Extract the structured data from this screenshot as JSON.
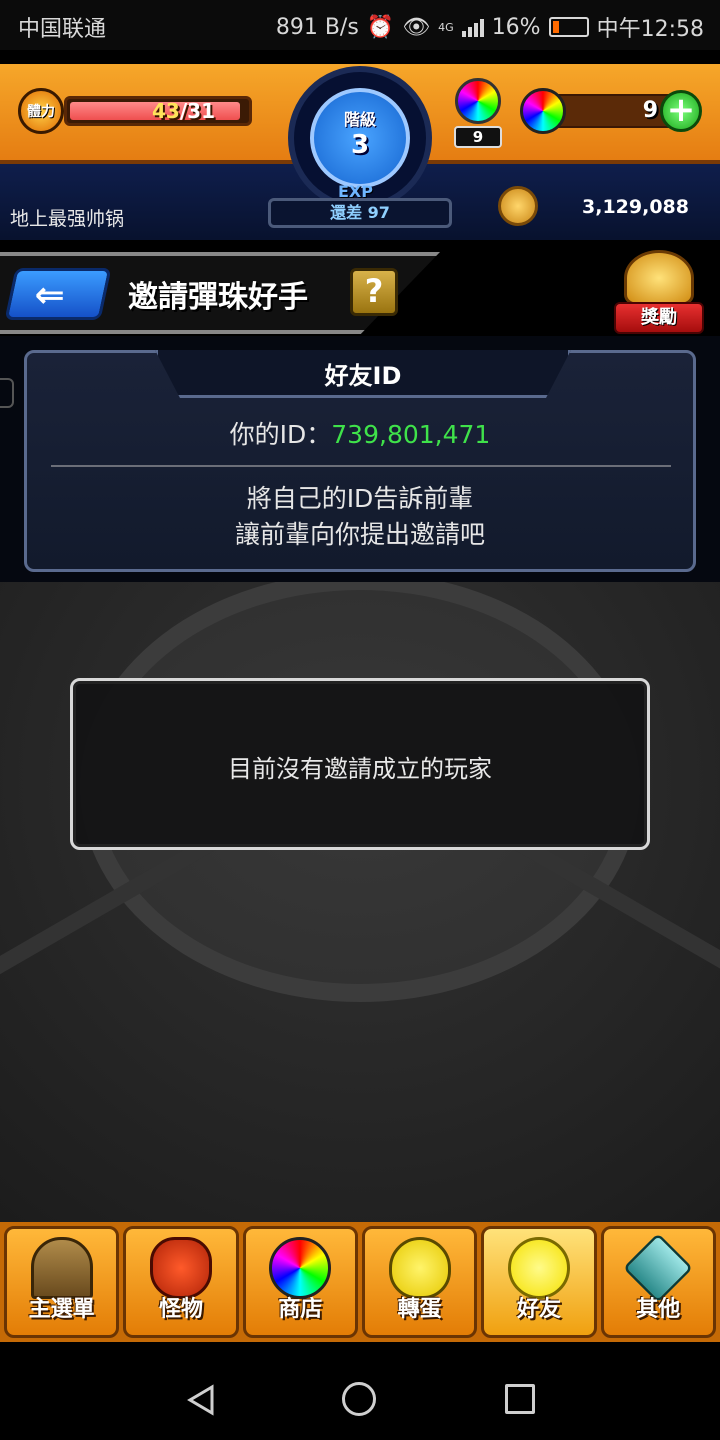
{
  "status_bar": {
    "carrier": "中国联通",
    "net_speed": "891 B/s",
    "battery": "16%",
    "time": "中午12:58",
    "signal_label": "4G"
  },
  "header": {
    "stamina_label": "體力",
    "stamina_current": "43",
    "stamina_max": "/31",
    "rank_label": "階級",
    "rank_value": "3",
    "exp_label": "EXP",
    "exp_remaining": "還差 97",
    "orb_count_small": "9",
    "orb_count": "9",
    "player_name": "地上最强帅锅",
    "coins": "3,129,088"
  },
  "titlebar": {
    "title": "邀請彈珠好手",
    "help": "?",
    "reward": "獎勵"
  },
  "id_panel": {
    "tab_title": "好友ID",
    "id_prefix": "你的ID：",
    "id_value": "739,801,471",
    "note_line1": "將自己的ID告訴前輩",
    "note_line2": "讓前輩向你提出邀請吧"
  },
  "empty_message": "目前沒有邀請成立的玩家",
  "bottom_nav": {
    "items": [
      {
        "label": "主選單",
        "icon": "home-gate-icon"
      },
      {
        "label": "怪物",
        "icon": "monster-icon"
      },
      {
        "label": "商店",
        "icon": "rainbow-orb-icon"
      },
      {
        "label": "轉蛋",
        "icon": "egg-icon"
      },
      {
        "label": "好友",
        "icon": "friend-balloons-icon"
      },
      {
        "label": "其他",
        "icon": "question-diamond-icon"
      }
    ]
  },
  "colors": {
    "header_orange": "#f6a72a",
    "id_green": "#3fe24a",
    "stamina_red": "#ef4f4f",
    "nav_orange": "#ffb83a"
  }
}
